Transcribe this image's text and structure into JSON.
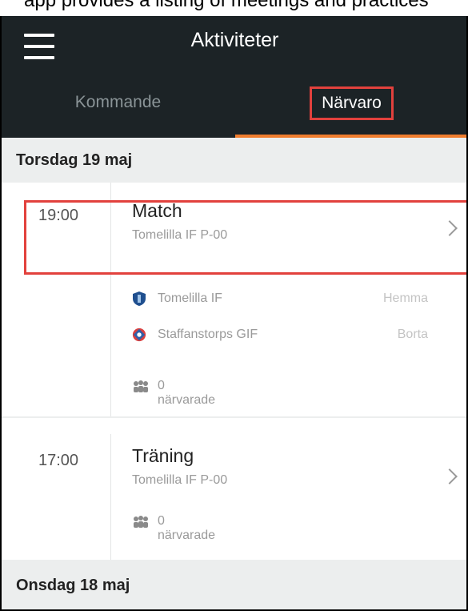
{
  "caption": "app provides a listing of meetings and practices",
  "header": {
    "title": "Aktiviteter"
  },
  "tabs": [
    {
      "label": "Kommande",
      "active": false
    },
    {
      "label": "Närvaro",
      "active": true
    }
  ],
  "days": [
    {
      "date": "Torsdag 19 maj",
      "activities": [
        {
          "time": "19:00",
          "title": "Match",
          "team": "Tomelilla IF P-00",
          "teams": [
            {
              "name": "Tomelilla IF",
              "venue": "Hemma",
              "icon": "shield-logo-icon"
            },
            {
              "name": "Staffanstorps GIF",
              "venue": "Borta",
              "icon": "badge-logo-icon"
            }
          ],
          "attendance": "0 närvarade",
          "highlighted": true
        },
        {
          "time": "17:00",
          "title": "Träning",
          "team": "Tomelilla IF P-00",
          "attendance": "0 närvarade",
          "highlighted": false
        }
      ]
    },
    {
      "date": "Onsdag 18 maj",
      "activities": []
    }
  ],
  "colors": {
    "appbar": "#1c2326",
    "tab_indicator": "#f07d2e",
    "highlight": "#e2413d",
    "day_header_bg": "#eceeee"
  }
}
